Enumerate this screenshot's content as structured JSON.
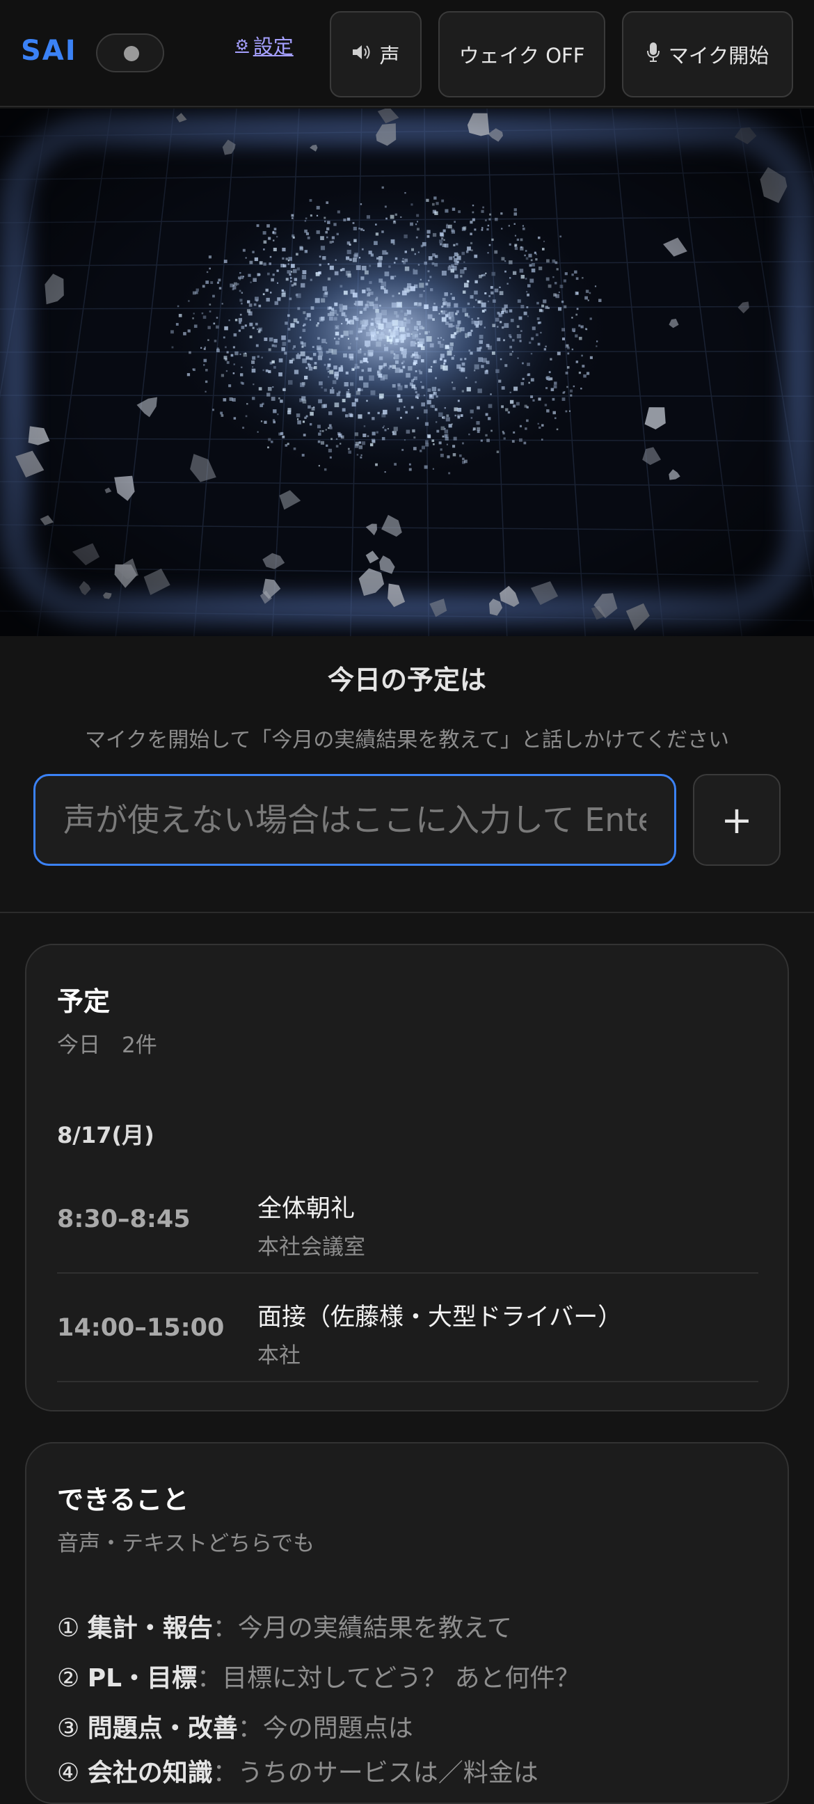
{
  "header": {
    "logo": "SAI",
    "settings_label": "設定",
    "voice_label": "声",
    "wake_label": "ウェイク OFF",
    "mic_label": "マイク開始",
    "accent": "#3b82f6"
  },
  "icons": {
    "settings": "gear-icon",
    "voice": "speaker-icon",
    "mic": "microphone-icon"
  },
  "prompt": {
    "title": "今日の予定は",
    "hint": "マイクを開始して「今月の実績結果を教えて」と話しかけてください",
    "input_placeholder": "声が使えない場合はここに入力して Enter",
    "input_value": "",
    "add_label": "+"
  },
  "schedule": {
    "title": "予定",
    "subtitle": "今日　2件",
    "date": "8/17(月)",
    "events": [
      {
        "time": "8:30–8:45",
        "title": "全体朝礼",
        "location": "本社会議室"
      },
      {
        "time": "14:00–15:00",
        "title": "面接（佐藤様・大型ドライバー）",
        "location": "本社"
      }
    ]
  },
  "abilities": {
    "title": "できること",
    "subtitle": "音声・テキストどちらでも",
    "items": [
      {
        "num": "①",
        "name": "集計・報告",
        "example": "今月の実績結果を教えて"
      },
      {
        "num": "②",
        "name": "PL・目標",
        "example": "目標に対してどう？ あと何件？"
      },
      {
        "num": "③",
        "name": "問題点・改善",
        "example": "今の問題点は"
      },
      {
        "num": "④",
        "name": "会社の知識",
        "example": "うちのサービスは／料金は"
      }
    ]
  }
}
